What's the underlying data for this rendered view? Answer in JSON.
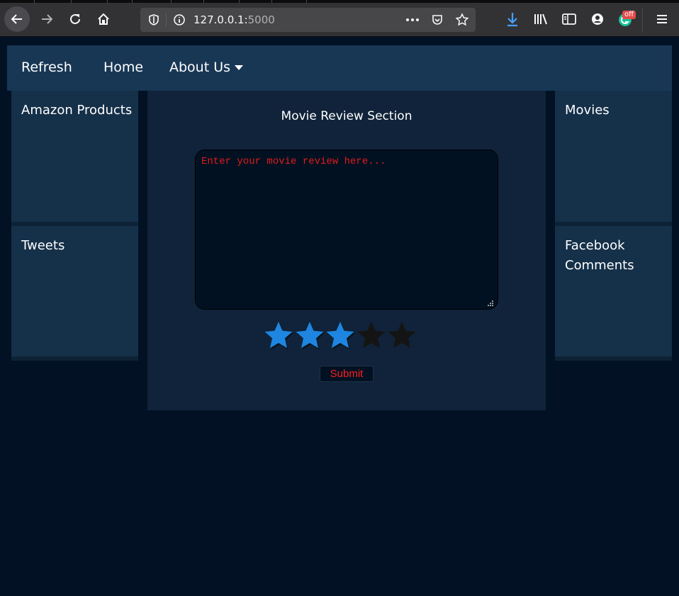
{
  "browser": {
    "url_host": "127.0.0.1:",
    "url_port": "5000",
    "extension_badge": "off"
  },
  "nav": {
    "items": [
      "Refresh",
      "Home",
      "About Us"
    ]
  },
  "left_sidebar": {
    "cards": [
      {
        "title": "Amazon Products"
      },
      {
        "title": "Tweets"
      }
    ]
  },
  "right_sidebar": {
    "cards": [
      {
        "title": "Movies"
      },
      {
        "title": "Facebook Comments"
      }
    ]
  },
  "review": {
    "section_title": "Movie Review Section",
    "placeholder": "Enter your movie review here...",
    "rating": 3,
    "max_rating": 5,
    "submit_label": "Submit"
  },
  "colors": {
    "page_bg": "#021224",
    "navbar_bg": "#183755",
    "panel_bg": "#10233a",
    "star_active": "#1e85e0",
    "star_inactive": "#141414",
    "accent_text": "#ff1e1e"
  }
}
